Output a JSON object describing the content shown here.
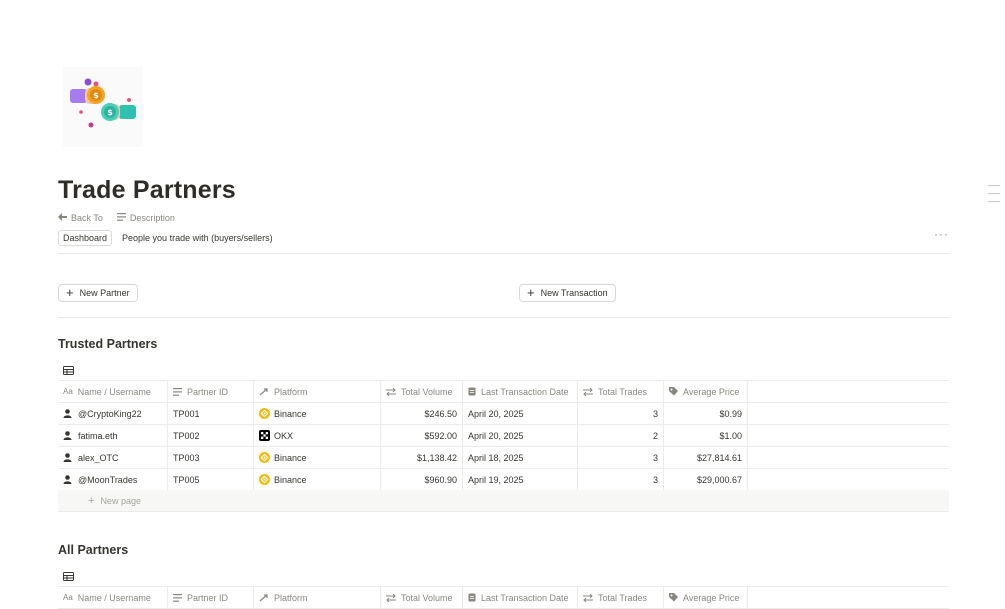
{
  "page": {
    "title": "Trade Partners",
    "icon": "handshake-crypto-icon"
  },
  "properties": {
    "back_to_label": "Back To",
    "description_label": "Description",
    "back_to_value": "Dashboard",
    "description_value": "People you trade with (buyers/sellers)"
  },
  "buttons": {
    "new_partner": "New Partner",
    "new_transaction": "New Transaction"
  },
  "columns": [
    {
      "label": "Name / Username",
      "icon": "text-aa-icon"
    },
    {
      "label": "Partner ID",
      "icon": "lines-icon"
    },
    {
      "label": "Platform",
      "icon": "relation-arrows-icon"
    },
    {
      "label": "Total Volume",
      "icon": "rollup-arrows-icon"
    },
    {
      "label": "Last Transaction Date",
      "icon": "doc-icon"
    },
    {
      "label": "Total Trades",
      "icon": "rollup-arrows-icon"
    },
    {
      "label": "Average Price",
      "icon": "tag-icon"
    }
  ],
  "trusted": {
    "title": "Trusted Partners",
    "rows": [
      {
        "name": "@CryptoKing22",
        "id": "TP001",
        "platform": "Binance",
        "platform_icon": "binance-icon",
        "volume": "$246.50",
        "date": "April 20, 2025",
        "trades": "3",
        "avg": "$0.99"
      },
      {
        "name": "fatima.eth",
        "id": "TP002",
        "platform": "OKX",
        "platform_icon": "okx-icon",
        "volume": "$592.00",
        "date": "April 20, 2025",
        "trades": "2",
        "avg": "$1.00"
      },
      {
        "name": "alex_OTC",
        "id": "TP003",
        "platform": "Binance",
        "platform_icon": "binance-icon",
        "volume": "$1,138.42",
        "date": "April 18, 2025",
        "trades": "3",
        "avg": "$27,814.61"
      },
      {
        "name": "@MoonTrades",
        "id": "TP005",
        "platform": "Binance",
        "platform_icon": "binance-icon",
        "volume": "$960.90",
        "date": "April 19, 2025",
        "trades": "3",
        "avg": "$29,000.67"
      }
    ],
    "new_page": "New page"
  },
  "all": {
    "title": "All Partners"
  },
  "colors": {
    "binance": "#f0b90b",
    "okx": "#000000",
    "text": "#37352f",
    "muted": "#8a8780"
  }
}
